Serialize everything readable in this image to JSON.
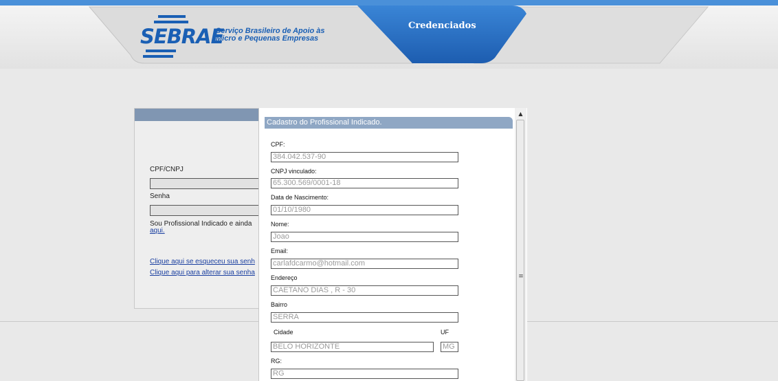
{
  "header": {
    "brand": "SEBRAE",
    "tagline_1": "Serviço Brasileiro de Apoio às",
    "tagline_2": "Micro e Pequenas Empresas",
    "active_tab": "Credenciados",
    "colors": {
      "brand_blue": "#1a5fb4",
      "tab_blue": "#2a6fc4"
    }
  },
  "login": {
    "cpf_label": "CPF/CNPJ",
    "cpf_value": "",
    "senha_label": "Senha",
    "senha_value": "",
    "indicado_text": "Sou Profissional Indicado e ainda",
    "aqui_link": "aqui.",
    "forgot_link": "Clique aqui se esqueceu sua senh",
    "change_link": "Clique aqui para alterar sua senha"
  },
  "modal": {
    "title": "Cadastro do Profissional Indicado.",
    "fields": {
      "cpf_label": "CPF:",
      "cpf_value": "384.042.537-90",
      "cnpj_label": "CNPJ vinculado:",
      "cnpj_value": "65.300.569/0001-18",
      "nascimento_label": "Data de Nascimento:",
      "nascimento_value": "01/10/1980",
      "nome_label": "Nome:",
      "nome_value": "Joao",
      "email_label": "Email:",
      "email_value": "carlafdcarmo@hotmail.com",
      "endereco_label": "Endereço",
      "endereco_value": "CAETANO DIAS , R - 30",
      "bairro_label": "Bairro",
      "bairro_value": "SERRA",
      "cidade_label": "Cidade",
      "cidade_value": "BELO HORIZONTE",
      "uf_label": "UF",
      "uf_value": "MG",
      "rg_label": "RG:",
      "rg_placeholder": "RG"
    }
  },
  "scrollbar": {
    "up_icon": "▲",
    "grip_icon": "≡"
  }
}
